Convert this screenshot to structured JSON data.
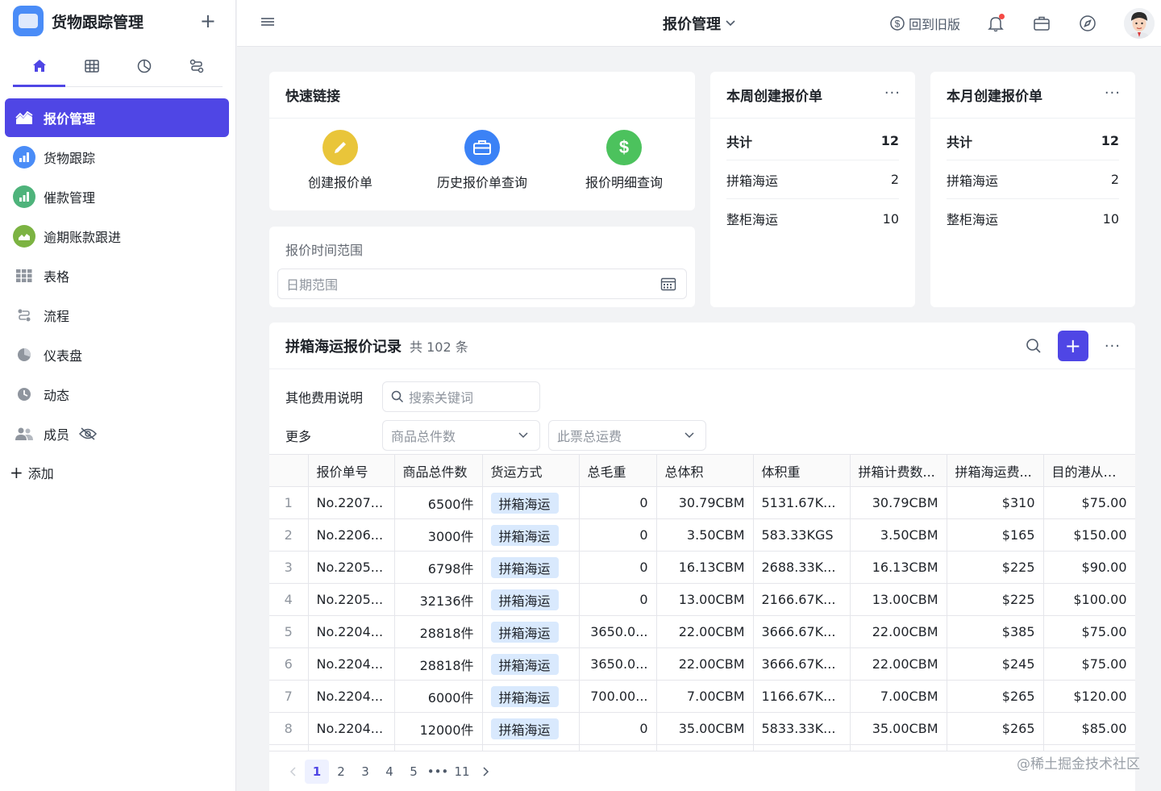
{
  "app": {
    "title": "货物跟踪管理"
  },
  "sidebar": {
    "items": [
      {
        "label": "报价管理",
        "icon": "area-chart-icon",
        "active": true
      },
      {
        "label": "货物跟踪",
        "icon": "bar-chart-icon",
        "color": "#4a8cf7"
      },
      {
        "label": "催款管理",
        "icon": "bar-chart-icon",
        "color": "#4eb37b"
      },
      {
        "label": "逾期账款跟进",
        "icon": "area-chart-icon",
        "color": "#7cb342"
      },
      {
        "label": "表格",
        "icon": "grid-icon"
      },
      {
        "label": "流程",
        "icon": "flow-icon"
      },
      {
        "label": "仪表盘",
        "icon": "pie-icon"
      },
      {
        "label": "动态",
        "icon": "clock-icon"
      },
      {
        "label": "成员",
        "icon": "members-icon"
      }
    ],
    "add_label": "添加"
  },
  "topbar": {
    "page_title": "报价管理",
    "old_version": "回到旧版"
  },
  "quick_links": {
    "title": "快速链接",
    "items": [
      {
        "label": "创建报价单",
        "color": "#e9c53a"
      },
      {
        "label": "历史报价单查询",
        "color": "#3b82f6"
      },
      {
        "label": "报价明细查询",
        "color": "#4cc25d"
      }
    ]
  },
  "date_filter": {
    "label": "报价时间范围",
    "placeholder": "日期范围"
  },
  "weekly": {
    "title": "本周创建报价单",
    "rows": [
      {
        "label": "共计",
        "value": "12"
      },
      {
        "label": "拼箱海运",
        "value": "2"
      },
      {
        "label": "整柜海运",
        "value": "10"
      }
    ]
  },
  "monthly": {
    "title": "本月创建报价单",
    "rows": [
      {
        "label": "共计",
        "value": "12"
      },
      {
        "label": "拼箱海运",
        "value": "2"
      },
      {
        "label": "整柜海运",
        "value": "10"
      }
    ]
  },
  "table": {
    "title": "拼箱海运报价记录",
    "count": "共 102 条",
    "filters": {
      "other_label": "其他费用说明",
      "search_placeholder": "搜索关键词",
      "more_label": "更多",
      "select1": "商品总件数",
      "select2": "此票总运费"
    },
    "columns": [
      "",
      "报价单号",
      "商品总件数",
      "货运方式",
      "总毛重",
      "总体积",
      "体积重",
      "拼箱计费数...",
      "拼箱海运费...",
      "目的港从码..."
    ],
    "rows": [
      [
        "1",
        "No.2207...",
        "6500件",
        "拼箱海运",
        "0",
        "30.79CBM",
        "5131.67K...",
        "30.79CBM",
        "$310",
        "$75.00"
      ],
      [
        "2",
        "No.2206...",
        "3000件",
        "拼箱海运",
        "0",
        "3.50CBM",
        "583.33KGS",
        "3.50CBM",
        "$165",
        "$150.00"
      ],
      [
        "3",
        "No.2205...",
        "6798件",
        "拼箱海运",
        "0",
        "16.13CBM",
        "2688.33K...",
        "16.13CBM",
        "$225",
        "$90.00"
      ],
      [
        "4",
        "No.2205...",
        "32136件",
        "拼箱海运",
        "0",
        "13.00CBM",
        "2166.67K...",
        "13.00CBM",
        "$225",
        "$100.00"
      ],
      [
        "5",
        "No.2204...",
        "28818件",
        "拼箱海运",
        "3650.0...",
        "22.00CBM",
        "3666.67K...",
        "22.00CBM",
        "$385",
        "$75.00"
      ],
      [
        "6",
        "No.2204...",
        "28818件",
        "拼箱海运",
        "3650.0...",
        "22.00CBM",
        "3666.67K...",
        "22.00CBM",
        "$245",
        "$75.00"
      ],
      [
        "7",
        "No.2204...",
        "6000件",
        "拼箱海运",
        "700.00...",
        "7.00CBM",
        "1166.67K...",
        "7.00CBM",
        "$265",
        "$120.00"
      ],
      [
        "8",
        "No.2204...",
        "12000件",
        "拼箱海运",
        "0",
        "35.00CBM",
        "5833.33K...",
        "35.00CBM",
        "$265",
        "$85.00"
      ]
    ]
  },
  "pagination": {
    "pages": [
      "1",
      "2",
      "3",
      "4",
      "5",
      "•••",
      "11"
    ],
    "current": "1"
  },
  "watermark": "@稀土掘金技术社区",
  "colors": {
    "accent": "#4f46e5",
    "tag_bg": "#d9e9fd"
  }
}
